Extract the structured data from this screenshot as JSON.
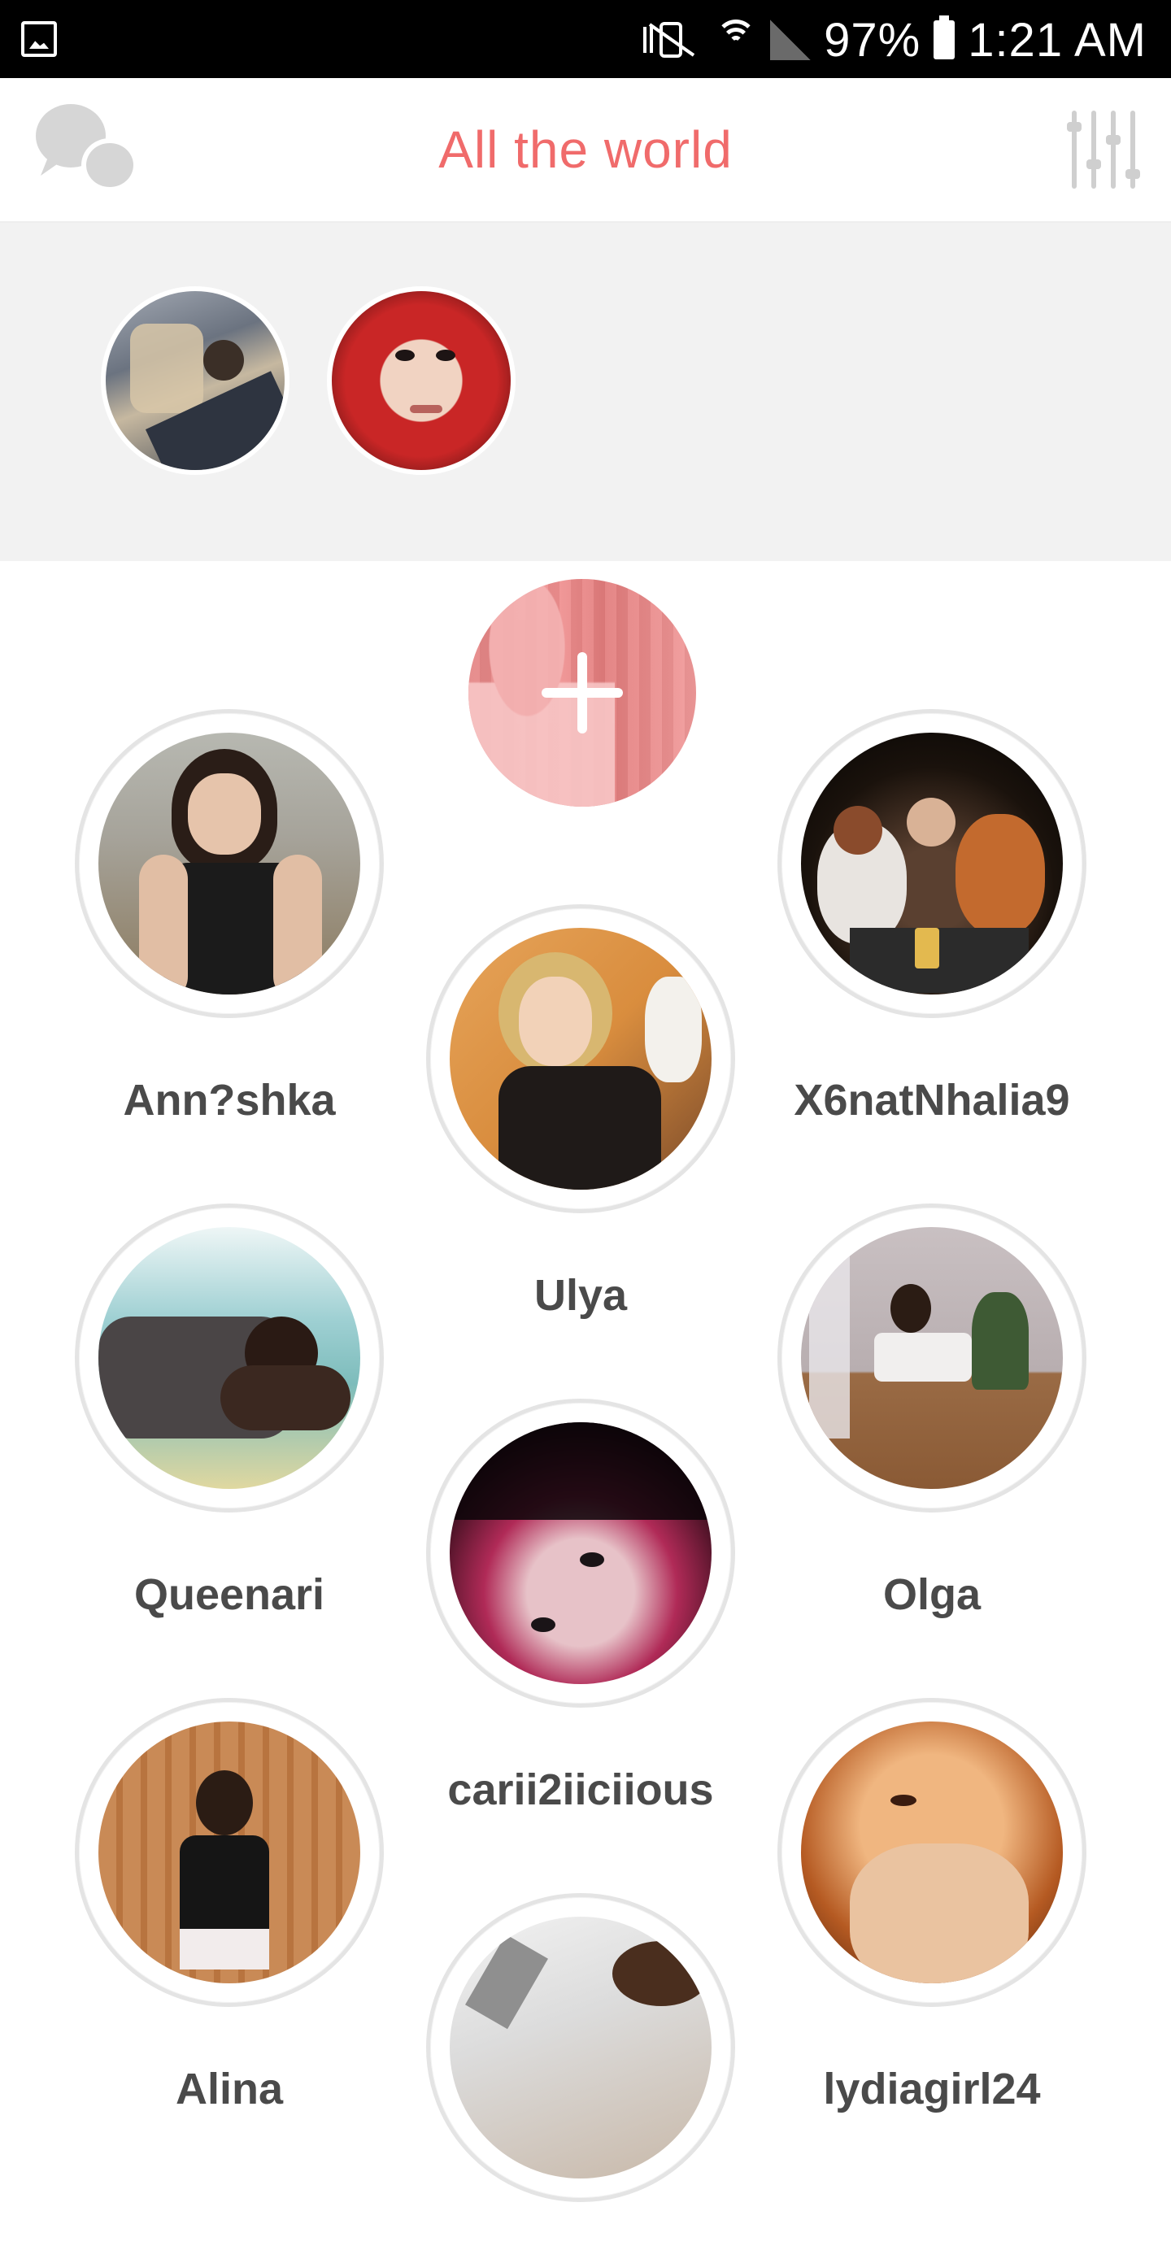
{
  "status_bar": {
    "battery": "97%",
    "time": "1:21 AM",
    "icons": [
      "gallery-icon",
      "vibrate-icon",
      "wifi-icon",
      "signal-icon",
      "battery-icon"
    ]
  },
  "header": {
    "title": "All the world",
    "left_icon": "chat-bubbles-icon",
    "right_icon": "filter-sliders-icon"
  },
  "colors": {
    "accent": "#f06b6b",
    "text": "#4a4a4a",
    "strip_background": "#f2f2f2"
  },
  "highlights": [
    {
      "name": "highlight-1"
    },
    {
      "name": "highlight-2"
    }
  ],
  "add_button": {
    "icon": "plus-icon"
  },
  "profiles": [
    {
      "name": "Ann?shka"
    },
    {
      "name": "X6natNhalia9"
    },
    {
      "name": "Ulya"
    },
    {
      "name": "Queenari"
    },
    {
      "name": "Olga"
    },
    {
      "name": "carii2iiciious"
    },
    {
      "name": "Alina"
    },
    {
      "name": "lydiagirl24"
    },
    {
      "name": ""
    }
  ]
}
